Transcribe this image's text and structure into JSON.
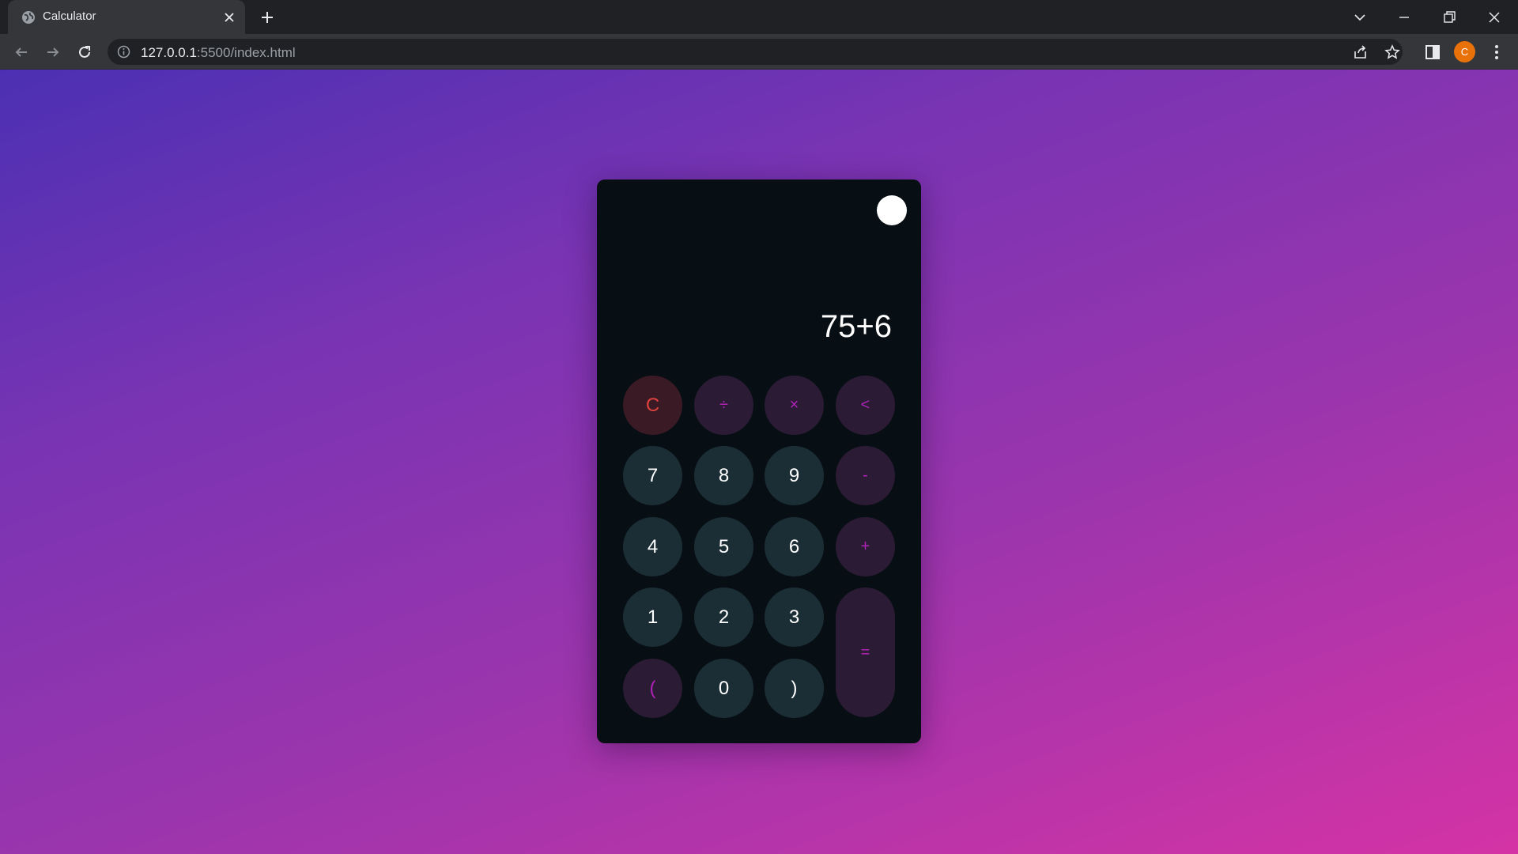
{
  "browser": {
    "tab_title": "Calculator",
    "url_host": "127.0.0.1",
    "url_rest": ":5500/index.html",
    "profile_initial": "C",
    "icons": [
      "globe-icon",
      "close-icon",
      "plus-icon",
      "chevron-down-icon",
      "minimize-icon",
      "restore-icon",
      "close-window-icon",
      "back-icon",
      "forward-icon",
      "reload-icon",
      "info-icon",
      "share-icon",
      "star-icon",
      "side-panel-icon",
      "menu-icon"
    ]
  },
  "calculator": {
    "display": "75+6",
    "keys": {
      "clear": "C",
      "divide": "÷",
      "multiply": "×",
      "backspace": "<",
      "seven": "7",
      "eight": "8",
      "nine": "9",
      "minus": "-",
      "four": "4",
      "five": "5",
      "six": "6",
      "plus": "+",
      "one": "1",
      "two": "2",
      "three": "3",
      "equals": "=",
      "open_paren": "(",
      "zero": "0",
      "close_paren": ")"
    },
    "colors": {
      "body": "#080f14",
      "number_key": "#1b2e36",
      "operator_key": "#2b1b35",
      "operator_text": "#b023b8",
      "clear_key": "#3a1a24",
      "clear_text": "#e0433f",
      "toggle": "#ffffff"
    }
  }
}
